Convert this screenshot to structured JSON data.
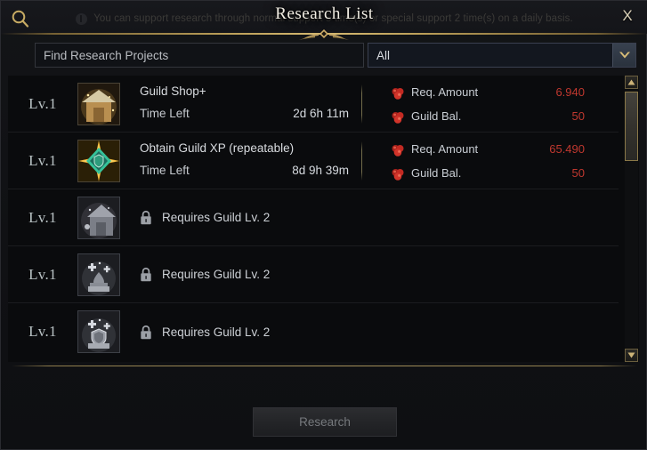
{
  "window": {
    "title": "Research List",
    "close_label": "X",
    "banner_text": "You can support research through normal support 5 time(s) or special support 2 time(s) on a daily basis."
  },
  "search": {
    "placeholder": "Find Research Projects",
    "value": "",
    "icon": "search-icon"
  },
  "filter": {
    "selected": "All",
    "icon": "chevron-down-icon"
  },
  "scrollbar": {
    "up_icon": "triangle-up-icon",
    "down_icon": "triangle-down-icon"
  },
  "list": {
    "rows": [
      {
        "level": "Lv.1",
        "icon": "guild-shop-icon",
        "locked": false,
        "name": "Guild Shop+",
        "time_label": "Time Left",
        "time_value": "2d 6h 11m",
        "req_label": "Req. Amount",
        "req_value": "6.940",
        "bal_label": "Guild Bal.",
        "bal_value": "50",
        "currency_icon": "red-gem-icon"
      },
      {
        "level": "Lv.1",
        "icon": "guild-xp-icon",
        "locked": false,
        "name": "Obtain Guild XP (repeatable)",
        "time_label": "Time Left",
        "time_value": "8d 9h 39m",
        "req_label": "Req. Amount",
        "req_value": "65.490",
        "bal_label": "Guild Bal.",
        "bal_value": "50",
        "currency_icon": "red-gem-icon"
      },
      {
        "level": "Lv.1",
        "icon": "locked-house-icon",
        "locked": true,
        "lock_icon": "lock-icon",
        "lock_text": "Requires Guild Lv. 2"
      },
      {
        "level": "Lv.1",
        "icon": "locked-potion-icon",
        "locked": true,
        "lock_icon": "lock-icon",
        "lock_text": "Requires Guild Lv. 2"
      },
      {
        "level": "Lv.1",
        "icon": "locked-shield-icon",
        "locked": true,
        "lock_icon": "lock-icon",
        "lock_text": "Requires Guild Lv. 2"
      }
    ]
  },
  "footer": {
    "action_label": "Research"
  },
  "colors": {
    "gold": "#c4a65c",
    "cost_red": "#c0382f",
    "text": "#d9dce0"
  }
}
